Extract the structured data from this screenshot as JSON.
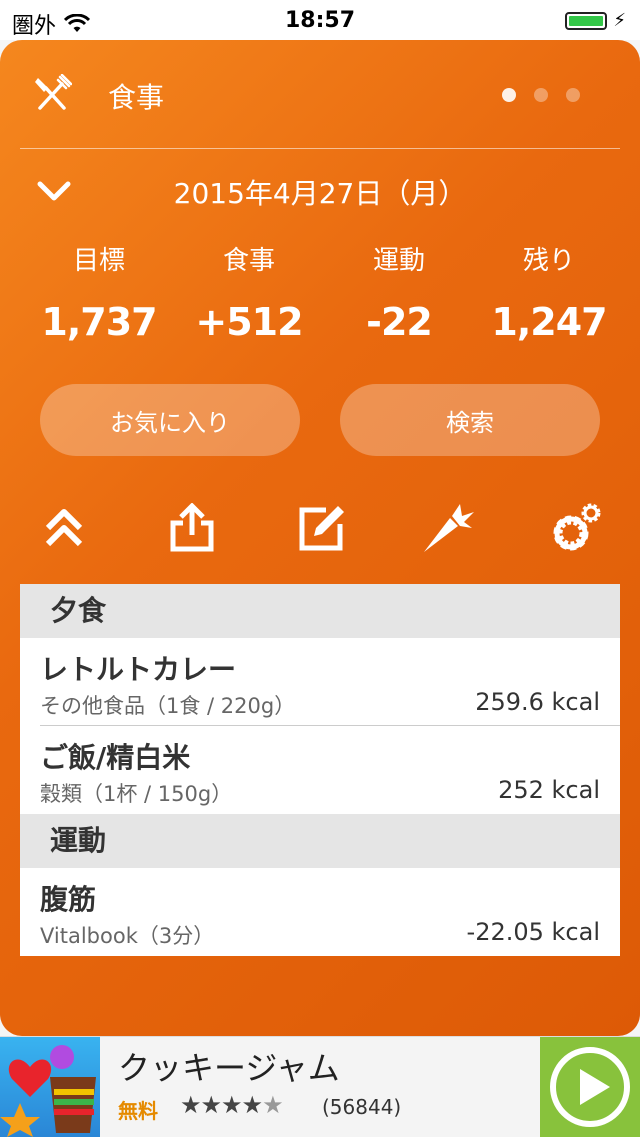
{
  "status_bar": {
    "carrier": "圏外",
    "time": "18:57"
  },
  "header": {
    "title": "食事",
    "page_dots": 3,
    "active_dot": 0
  },
  "date": "2015年4月27日（月）",
  "stats": [
    {
      "label": "目標",
      "value": "1,737"
    },
    {
      "label": "食事",
      "value": "+512"
    },
    {
      "label": "運動",
      "value": "-22"
    },
    {
      "label": "残り",
      "value": "1,247"
    }
  ],
  "buttons": {
    "favorites": "お気に入り",
    "search": "検索"
  },
  "toolbar_icons": [
    "collapse-up-icon",
    "share-icon",
    "edit-icon",
    "carrot-icon",
    "settings-icon"
  ],
  "sections": [
    {
      "title": "夕食",
      "items": [
        {
          "name": "レトルトカレー",
          "detail": "その他食品（1食 / 220g）",
          "kcal": "259.6 kcal"
        },
        {
          "name": "ご飯/精白米",
          "detail": "穀類（1杯 / 150g）",
          "kcal": "252 kcal"
        }
      ]
    },
    {
      "title": "運動",
      "items": [
        {
          "name": "腹筋",
          "detail": "Vitalbook（3分）",
          "kcal": "-22.05 kcal"
        }
      ]
    }
  ],
  "ad": {
    "app_name": "クッキージャム",
    "price": "無料",
    "rating": 4.5,
    "rating_count": "(56844)"
  },
  "colors": {
    "accent_orange": "#e9690f",
    "battery_green": "#33c748",
    "ad_play_green": "#88c23c"
  }
}
